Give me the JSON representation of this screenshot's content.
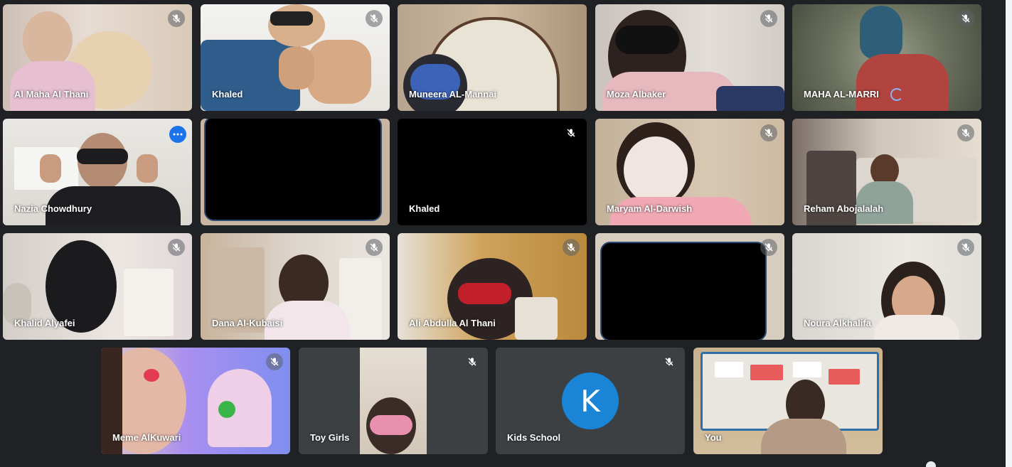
{
  "meeting": {
    "participants": [
      {
        "name": "Al Maha Al Thani",
        "muted": true
      },
      {
        "name": "Khaled",
        "muted": true
      },
      {
        "name": "Muneera AL-Mannai",
        "muted": false
      },
      {
        "name": "Moza Albaker",
        "muted": true
      },
      {
        "name": "MAHA AL-MARRI",
        "muted": true
      },
      {
        "name": "Nazia Chowdhury",
        "muted": false,
        "active_speaker": true
      },
      {
        "name": "",
        "muted": false,
        "video_off": true
      },
      {
        "name": "Khaled",
        "muted": true,
        "video_off": true
      },
      {
        "name": "Maryam Al-Darwish",
        "muted": true
      },
      {
        "name": "Reham Abojalalah",
        "muted": true
      },
      {
        "name": "Khalid Alyafei",
        "muted": true
      },
      {
        "name": "Dana Al-Kubaisi",
        "muted": true
      },
      {
        "name": "Ali Abdulla Al Thani",
        "muted": true
      },
      {
        "name": "",
        "muted": true,
        "video_off": true
      },
      {
        "name": "Noura Alkhalifa",
        "muted": true
      },
      {
        "name": "Meme AlKuwari",
        "muted": true
      },
      {
        "name": "Toy Girls",
        "muted": true
      },
      {
        "name": "Kids School",
        "muted": true,
        "avatar_letter": "K"
      },
      {
        "name": "You",
        "muted": false
      }
    ]
  },
  "colors": {
    "background": "#202124",
    "tile": "#3c4043",
    "accent": "#1a73e8",
    "active_outline": "#8ab4f8",
    "avatar": "#1a84d6"
  },
  "icons": {
    "mute": "mic-off-icon",
    "more": "more-options-icon",
    "loading": "loading-spinner-icon"
  }
}
